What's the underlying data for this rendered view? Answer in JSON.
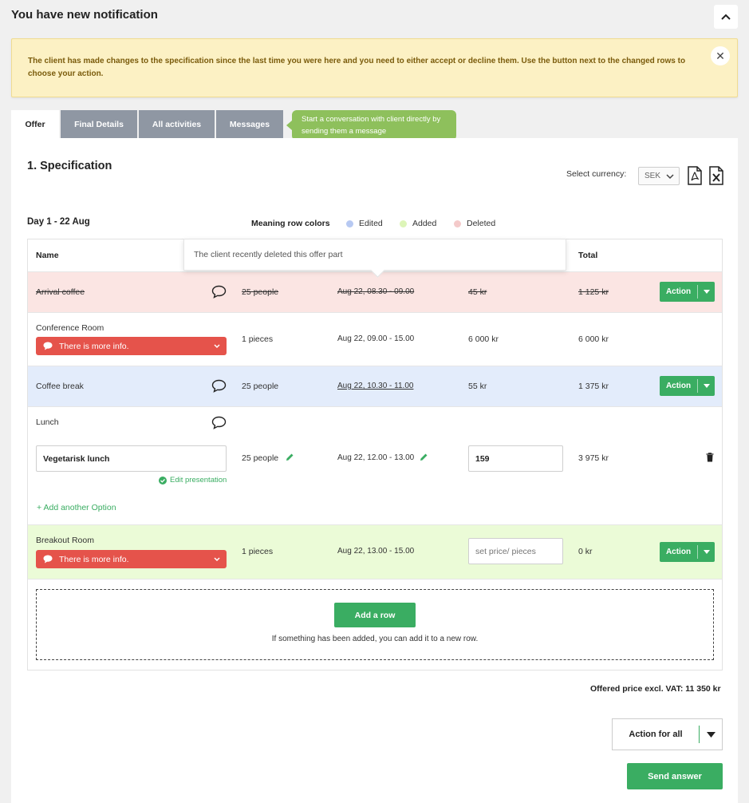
{
  "notification": {
    "title": "You have new notification",
    "message": "The client has made changes to the specification since the last time you were here and you need to either accept or decline them. Use the button next to the changed rows to choose your action.",
    "close_glyph": "✕"
  },
  "tabs": [
    {
      "label": "Offer",
      "active": true
    },
    {
      "label": "Final Details",
      "active": false
    },
    {
      "label": "All activities",
      "active": false
    },
    {
      "label": "Messages",
      "active": false
    }
  ],
  "messages_tip": "Start a conversation with client directly by sending them a message",
  "spec": {
    "title": "1. Specification",
    "currency_label": "Select currency:",
    "currency_value": "SEK"
  },
  "day": {
    "label": "Day 1 - 22 Aug",
    "legend_title": "Meaning row colors",
    "legend": [
      {
        "label": "Edited",
        "color": "#b7c9f2"
      },
      {
        "label": "Added",
        "color": "#ddf5b8"
      },
      {
        "label": "Deleted",
        "color": "#f4caca"
      }
    ]
  },
  "table": {
    "headers": {
      "name": "Name",
      "total": "Total"
    },
    "deleted_tooltip": "The client recently deleted this offer part",
    "rows": {
      "arrival": {
        "name": "Arrival coffee",
        "qty": "25 people",
        "time": "Aug 22, 08.30 - 09.00",
        "price": "45 kr",
        "total": "1 125 kr",
        "action": "Action"
      },
      "conference": {
        "name": "Conference Room",
        "info": "There is more info.",
        "qty": "1 pieces",
        "time": "Aug 22, 09.00 - 15.00",
        "price": "6 000 kr",
        "total": "6 000 kr"
      },
      "coffee": {
        "name": "Coffee break",
        "qty": "25 people",
        "time": "Aug 22, 10.30 - 11.00",
        "price": "55 kr",
        "total": "1 375 kr",
        "action": "Action"
      },
      "lunch": {
        "name": "Lunch",
        "option_value": "Vegetarisk lunch",
        "edit_presentation": "Edit presentation",
        "qty": "25 people",
        "time": "Aug 22, 12.00 - 13.00",
        "price_value": "159",
        "total": "3 975 kr",
        "add_option": "+ Add another Option"
      },
      "breakout": {
        "name": "Breakout Room",
        "info": "There is more info.",
        "qty": "1 pieces",
        "time": "Aug 22, 13.00 - 15.00",
        "price_placeholder": "set price/ pieces",
        "total": "0 kr",
        "action": "Action"
      }
    },
    "add_row": {
      "button": "Add a row",
      "hint": "If something has been added, you can add it to a new row."
    }
  },
  "summary": {
    "total": "Offered price excl. VAT: 11 350 kr",
    "action_all": "Action for all",
    "send": "Send answer"
  },
  "colors": {
    "deleted_row": "#fbe5e3",
    "edited_row": "#e3ecfb",
    "added_row": "#ebfbd7",
    "primary_green": "#3aad62",
    "info_red": "#e5534b"
  }
}
